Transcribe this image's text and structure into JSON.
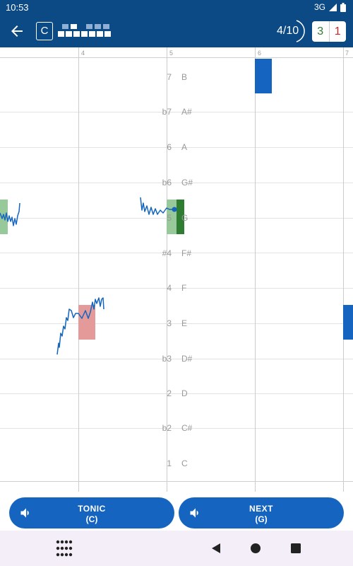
{
  "status": {
    "time": "10:53",
    "network": "3G"
  },
  "header": {
    "key": "C",
    "progress": "4/10",
    "correct": "3",
    "wrong": "1"
  },
  "bars": [
    "4",
    "5",
    "6",
    "7"
  ],
  "degrees": [
    {
      "num": "7",
      "note": "B"
    },
    {
      "num": "b7",
      "note": "A#"
    },
    {
      "num": "6",
      "note": "A"
    },
    {
      "num": "b6",
      "note": "G#"
    },
    {
      "num": "5",
      "note": "G"
    },
    {
      "num": "#4",
      "note": "F#"
    },
    {
      "num": "4",
      "note": "F"
    },
    {
      "num": "3",
      "note": "E"
    },
    {
      "num": "b3",
      "note": "D#"
    },
    {
      "num": "2",
      "note": "D"
    },
    {
      "num": "b2",
      "note": "C#"
    },
    {
      "num": "1",
      "note": "C"
    }
  ],
  "buttons": {
    "tonic": {
      "label": "TONIC",
      "note": "(C)"
    },
    "next": {
      "label": "NEXT",
      "note": "(G)"
    }
  },
  "colors": {
    "primary": "#0b4a85",
    "accent": "#1565c0",
    "correct": "#2e7d32",
    "wrong": "#c62828"
  }
}
